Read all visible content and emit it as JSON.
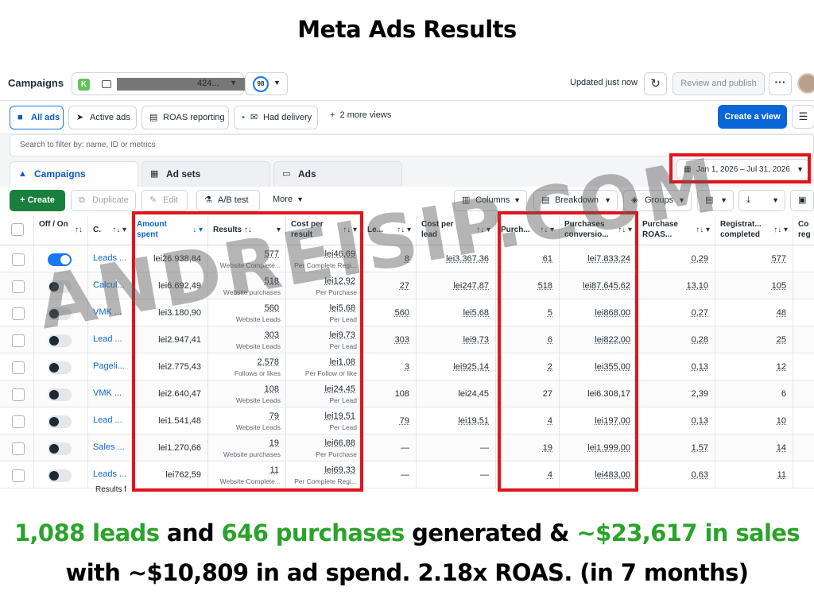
{
  "title": "Meta Ads Results",
  "topbar": {
    "page": "Campaigns",
    "account_badge": "K",
    "account_suffix": "424...",
    "score": "98",
    "updated": "Updated just now",
    "review_publish": "Review and publish",
    "more": "···"
  },
  "views": {
    "all_ads": "All ads",
    "active_ads": "Active ads",
    "roas_reporting": "ROAS reporting",
    "had_delivery": "Had delivery",
    "more_views": "2 more views",
    "create_view": "Create a view"
  },
  "search": {
    "placeholder": "Search to filter by: name, ID or metrics"
  },
  "tabs": {
    "campaigns": "Campaigns",
    "ad_sets": "Ad sets",
    "ads": "Ads"
  },
  "date_range": "Jan 1, 2026 – Jul 31, 2026",
  "toolbar": {
    "create": "Create",
    "duplicate": "Duplicate",
    "edit": "Edit",
    "ab_test": "A/B test",
    "more": "More",
    "columns": "Columns",
    "breakdown": "Breakdown",
    "groups": "Groups"
  },
  "columns": {
    "off_on": "Off / On",
    "name": "C.",
    "amount_spent": "Amount spent",
    "results": "Results",
    "cost_per_result": "Cost per result",
    "leads": "Le...",
    "cost_per_lead": "Cost per lead",
    "purchases": "Purch...",
    "purchases_conversion": "Purchases conversio...",
    "purchase_roas": "Purchase ROAS...",
    "registrations": "Registrat... completed",
    "cost_reg": "Co reg"
  },
  "rows": [
    {
      "on": true,
      "name": "Leads ...",
      "spent": "lei26.938,84",
      "results": "577",
      "results_sub": "Website Complete...",
      "cpr": "lei46,69",
      "cpr_sub": "Per Complete Regi...",
      "leads": "8",
      "cpl": "lei3.367,36",
      "purch": "61",
      "pconv": "lei7.833,24",
      "roas": "0,29",
      "reg": "577"
    },
    {
      "on": false,
      "name": "Calcul...",
      "spent": "lei6.692,49",
      "results": "518",
      "results_sub": "Website purchases",
      "cpr": "lei12,92",
      "cpr_sub": "Per Purchase",
      "leads": "27",
      "cpl": "lei247,87",
      "purch": "518",
      "pconv": "lei87.645,62",
      "roas": "13,10",
      "reg": "105"
    },
    {
      "on": false,
      "name": "VMK ...",
      "spent": "lei3.180,90",
      "results": "560",
      "results_sub": "Website Leads",
      "cpr": "lei5,68",
      "cpr_sub": "Per Lead",
      "leads": "560",
      "cpl": "lei5,68",
      "purch": "5",
      "pconv": "lei868,00",
      "roas": "0,27",
      "reg": "48"
    },
    {
      "on": false,
      "name": "Lead ...",
      "spent": "lei2.947,41",
      "results": "303",
      "results_sub": "Website Leads",
      "cpr": "lei9,73",
      "cpr_sub": "Per Lead",
      "leads": "303",
      "cpl": "lei9,73",
      "purch": "6",
      "pconv": "lei822,00",
      "roas": "0,28",
      "reg": "25"
    },
    {
      "on": false,
      "name": "Pageli...",
      "spent": "lei2.775,43",
      "results": "2.578",
      "results_sub": "Follows or likes",
      "cpr": "lei1,08",
      "cpr_sub": "Per Follow or like",
      "leads": "3",
      "cpl": "lei925,14",
      "purch": "2",
      "pconv": "lei355,00",
      "roas": "0,13",
      "reg": "12"
    },
    {
      "on": false,
      "name": "VMK ...",
      "spent": "lei2.640,47",
      "results": "108",
      "results_sub": "Website Leads",
      "cpr": "lei24,45",
      "cpr_sub": "Per Lead",
      "leads": "108",
      "cpl": "lei24,45",
      "purch": "27",
      "pconv": "lei6.308,17",
      "roas": "2,39",
      "reg": "6"
    },
    {
      "on": false,
      "name": "Lead ...",
      "spent": "lei1.541,48",
      "results": "79",
      "results_sub": "Website Leads",
      "cpr": "lei19,51",
      "cpr_sub": "Per Lead",
      "leads": "79",
      "cpl": "lei19,51",
      "purch": "4",
      "pconv": "lei197,00",
      "roas": "0,13",
      "reg": "10"
    },
    {
      "on": false,
      "name": "Sales ...",
      "spent": "lei1.270,66",
      "results": "19",
      "results_sub": "Website purchases",
      "cpr": "lei66,88",
      "cpr_sub": "Per Purchase",
      "leads": "—",
      "cpl": "—",
      "purch": "19",
      "pconv": "lei1.999,00",
      "roas": "1,57",
      "reg": "14"
    },
    {
      "on": false,
      "name": "Leads ...",
      "spent": "lei762,59",
      "results": "11",
      "results_sub": "Website Complete...",
      "cpr": "lei69,33",
      "cpr_sub": "Per Complete Regi...",
      "leads": "—",
      "cpl": "—",
      "purch": "4",
      "pconv": "lei483,00",
      "roas": "0,63",
      "reg": "11"
    }
  ],
  "results_footer": "Results f",
  "watermark": "ANDREISIP.COM",
  "caption": {
    "leads": "1,088 leads",
    "and": " and ",
    "purchases": "646 purchases",
    "generated": " generated & ",
    "sales": "~$23,617 in sales",
    "line2": "with ~$10,809 in ad spend. 2.18x ROAS. (in 7 months)"
  },
  "colors": {
    "highlight": "#e3141b",
    "accent": "#0a66d6",
    "create": "#1a7f3d",
    "caption_green": "#2aa32a"
  }
}
